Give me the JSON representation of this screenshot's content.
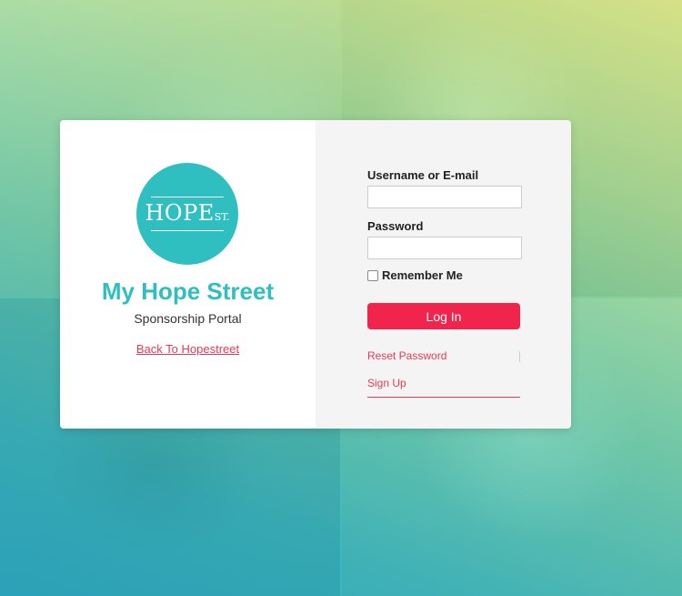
{
  "logo": {
    "text": "HOPE",
    "suffix": "ST."
  },
  "site": {
    "title": "My Hope Street",
    "subtitle": "Sponsorship Portal",
    "back_link": "Back To Hopestreet"
  },
  "login": {
    "username_label": "Username or E-mail",
    "username_value": "",
    "password_label": "Password",
    "password_value": "",
    "remember_label": "Remember Me",
    "login_button": "Log In",
    "reset_link": "Reset Password",
    "signup_link": "Sign Up"
  },
  "colors": {
    "brand_teal": "#2fbfc1",
    "accent_red": "#f0244c",
    "link_red": "#e83a56"
  }
}
